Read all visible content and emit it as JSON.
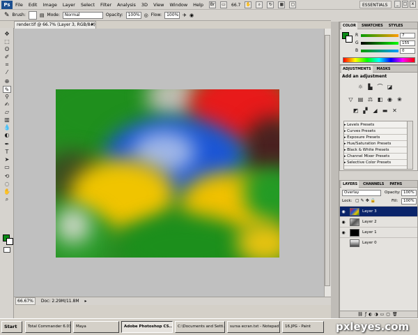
{
  "menubar": {
    "logo": "Ps",
    "items": [
      "File",
      "Edit",
      "Image",
      "Layer",
      "Select",
      "Filter",
      "Analysis",
      "3D",
      "View",
      "Window",
      "Help"
    ],
    "zoom": "66.7",
    "workspace": "ESSENTIALS",
    "window_controls": [
      "_",
      "□",
      "x"
    ]
  },
  "options": {
    "brush_label": "Brush:",
    "mode_label": "Mode:",
    "mode_value": "Normal",
    "opacity_label": "Opacity:",
    "opacity_value": "100%",
    "flow_label": "Flow:",
    "flow_value": "100%"
  },
  "document": {
    "tab_title": "render.tif @ 66.7% (Layer 3, RGB/8#) *",
    "close": "×"
  },
  "statusbar": {
    "zoom": "66.67%",
    "doc_info": "Doc: 2.29M/11.8M"
  },
  "color_panel": {
    "tabs": [
      "COLOR",
      "SWATCHES",
      "STYLES"
    ],
    "channels": [
      {
        "label": "R",
        "value": "7"
      },
      {
        "label": "G",
        "value": "155"
      },
      {
        "label": "B",
        "value": "0"
      }
    ],
    "fg_color": "#0a8a16"
  },
  "adjustments_panel": {
    "tabs": [
      "ADJUSTMENTS",
      "MASKS"
    ],
    "title": "Add an adjustment",
    "presets": [
      "Levels Presets",
      "Curves Presets",
      "Exposure Presets",
      "Hue/Saturation Presets",
      "Black & White Presets",
      "Channel Mixer Presets",
      "Selective Color Presets"
    ]
  },
  "layers_panel": {
    "tabs": [
      "LAYERS",
      "CHANNELS",
      "PATHS"
    ],
    "blend_mode": "Overlay",
    "opacity_label": "Opacity:",
    "opacity_value": "100%",
    "lock_label": "Lock:",
    "fill_label": "Fill:",
    "fill_value": "100%",
    "layers": [
      {
        "name": "Layer 3",
        "selected": true
      },
      {
        "name": "Layer 2",
        "selected": false
      },
      {
        "name": "Layer 1",
        "selected": false
      },
      {
        "name": "Layer 0",
        "selected": false
      }
    ]
  },
  "taskbar": {
    "start": "Start",
    "items": [
      "Total Commander 6.03 ...",
      "Maya",
      "Adobe Photoshop CS...",
      "C:\\Documents and Setti...",
      "sursa ecran.txt - Notepad",
      "16.JPG - Paint"
    ],
    "active_index": 2
  },
  "watermark": "pxleyes.com"
}
